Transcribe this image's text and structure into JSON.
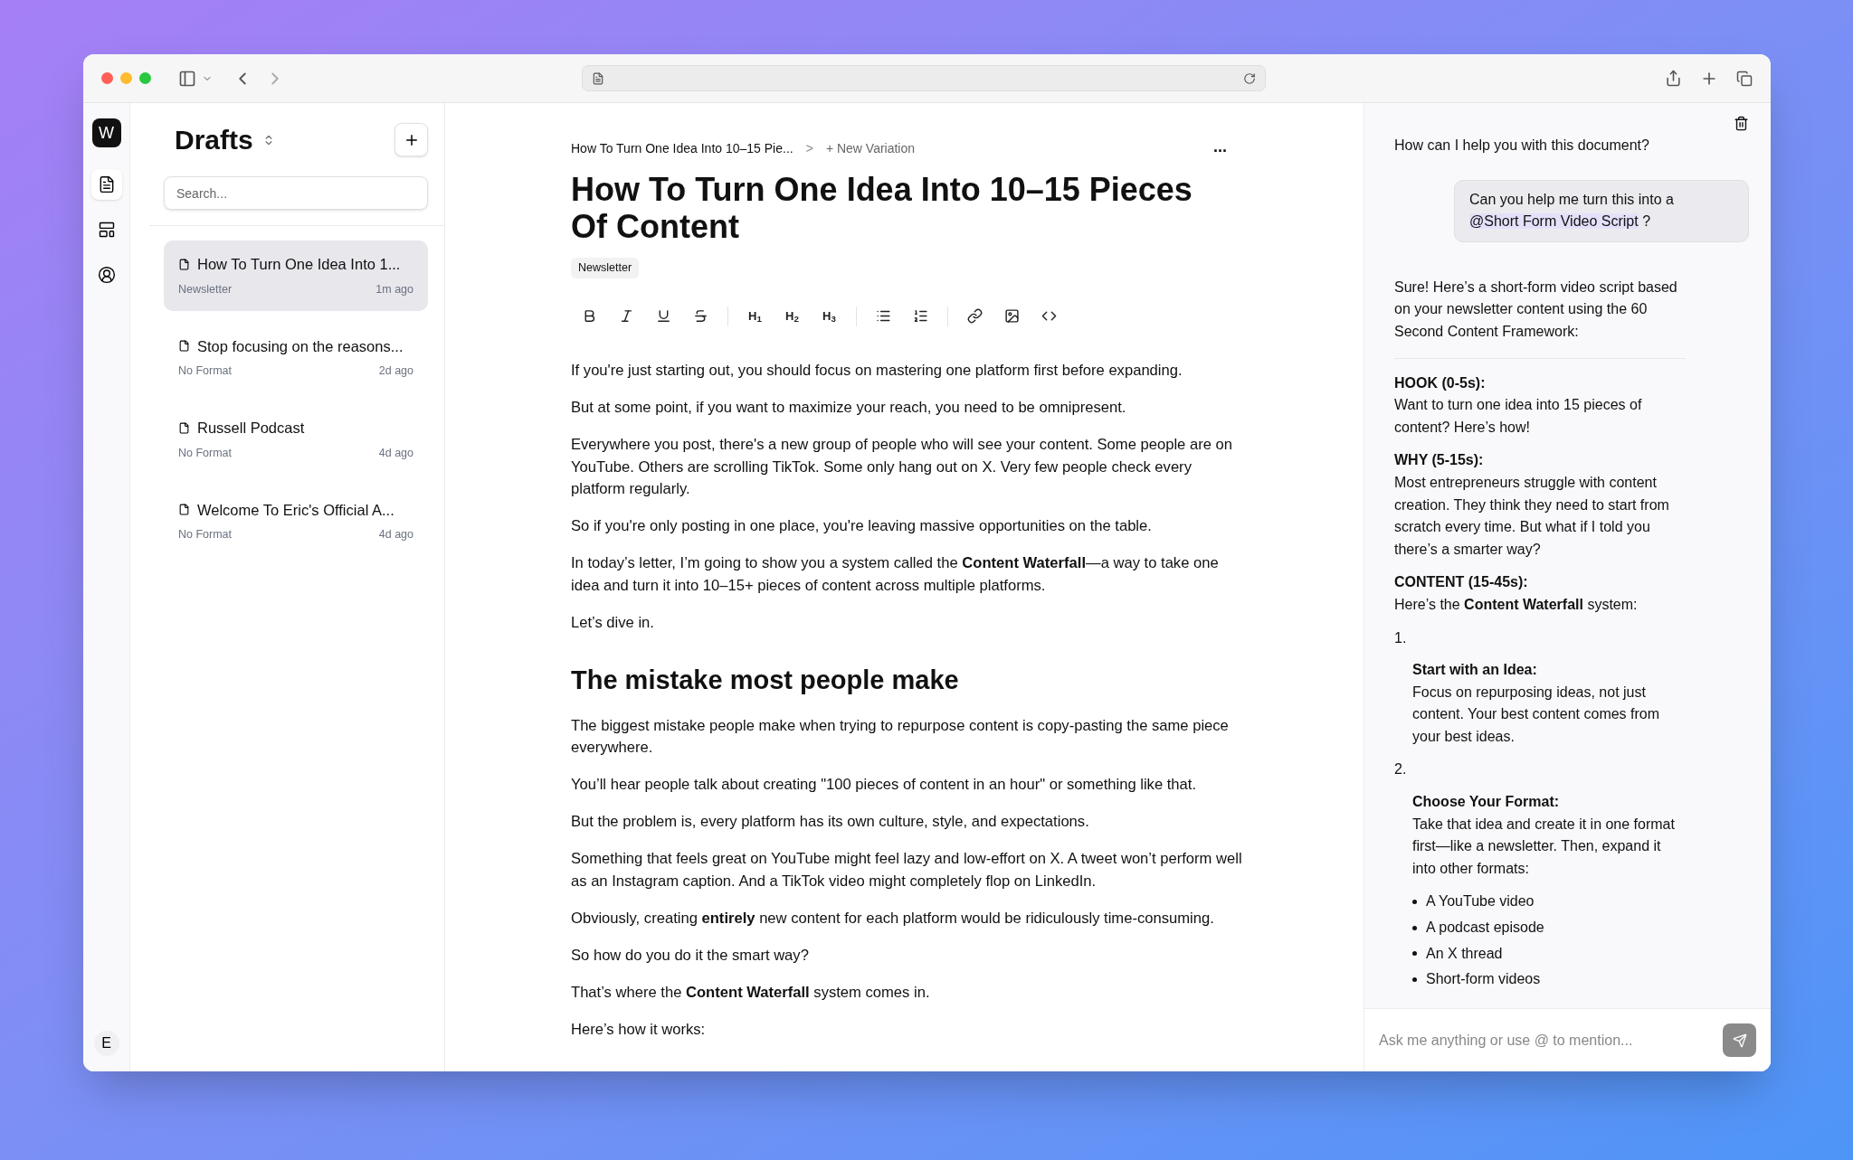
{
  "rail": {
    "logo": "W",
    "user_initial": "E",
    "items": [
      {
        "selected": true
      },
      {
        "selected": false
      },
      {
        "selected": false
      }
    ]
  },
  "drafts": {
    "title": "Drafts",
    "search": {
      "placeholder": "Search..."
    },
    "items": [
      {
        "title": "How To Turn One Idea Into 1...",
        "format": "Newsletter",
        "time": "1m ago",
        "selected": true
      },
      {
        "title": "Stop focusing on the reasons...",
        "format": "No Format",
        "time": "2d ago",
        "selected": false
      },
      {
        "title": "Russell Podcast",
        "format": "No Format",
        "time": "4d ago",
        "selected": false
      },
      {
        "title": "Welcome To Eric's Official A...",
        "format": "No Format",
        "time": "4d ago",
        "selected": false
      }
    ]
  },
  "editor": {
    "breadcrumb": "How To Turn One Idea Into 10–15 Pie...",
    "breadcrumb_separator": ">",
    "new_variation": "+ New Variation",
    "more": "...",
    "title": "How To Turn One Idea Into 10–15 Pieces Of Content",
    "tag": "Newsletter",
    "toolbar": [
      {
        "kind": "bold"
      },
      {
        "kind": "italic"
      },
      {
        "kind": "underline"
      },
      {
        "kind": "strike"
      },
      {
        "kind": "separator"
      },
      {
        "kind": "heading",
        "label": "H$_{1}$"
      },
      {
        "kind": "heading",
        "label": "H$_{2}$"
      },
      {
        "kind": "heading",
        "label": "H$_{3}$"
      },
      {
        "kind": "separator"
      },
      {
        "kind": "bullets"
      },
      {
        "kind": "numbers"
      },
      {
        "kind": "separator"
      },
      {
        "kind": "link"
      },
      {
        "kind": "image"
      },
      {
        "kind": "code"
      }
    ],
    "blocks": [
      {
        "kind": "p",
        "text": "If you're just starting out, you should focus on mastering one platform first before expanding."
      },
      {
        "kind": "p",
        "text": "But at some point, if you want to maximize your reach, you need to be omnipresent."
      },
      {
        "kind": "p",
        "text": "Everywhere you post, there's a new group of people who will see your content. Some people are on YouTube. Others are scrolling TikTok. Some only hang out on X. Very few people check every platform regularly."
      },
      {
        "kind": "p",
        "text": "So if you're only posting in one place, you're leaving massive opportunities on the table."
      },
      {
        "kind": "p",
        "text": "In today’s letter, I’m going to show you a system called the **Content Waterfall**—a way to take one idea and turn it into 10–15+ pieces of content across multiple platforms."
      },
      {
        "kind": "p",
        "text": "Let’s dive in."
      },
      {
        "kind": "h2",
        "text": "The mistake most people make"
      },
      {
        "kind": "p",
        "text": "The biggest mistake people make when trying to repurpose content is copy-pasting the same piece everywhere."
      },
      {
        "kind": "p",
        "text": "You’ll hear people talk about creating \"100 pieces of content in an hour\" or something like that."
      },
      {
        "kind": "p",
        "text": "But the problem is, every platform has its own culture, style, and expectations."
      },
      {
        "kind": "p",
        "text": "Something that feels great on YouTube might feel lazy and low-effort on X. A tweet won’t perform well as an Instagram caption. And a TikTok video might completely flop on LinkedIn."
      },
      {
        "kind": "p",
        "text": "Obviously, creating **entirely** new content for each platform would be ridiculously time-consuming."
      },
      {
        "kind": "p",
        "text": "So how do you do it the smart way?"
      },
      {
        "kind": "p",
        "text": "That’s where the **Content Waterfall** system comes in."
      },
      {
        "kind": "p",
        "text": "Here’s how it works:"
      }
    ]
  },
  "chat": {
    "greeting": "How can I help you with this document?",
    "user_message": {
      "text": "Can you help me turn this into a",
      "mention": "@Short Form Video Script",
      "suffix": "?"
    },
    "intro": "Sure! Here’s a short-form video script based on your newsletter content using the 60 Second Content Framework:",
    "sections": [
      {
        "heading": "HOOK (0-5s):",
        "text": "Want to turn one idea into 15 pieces of content? Here’s how!"
      },
      {
        "heading": "WHY (5-15s):",
        "text": "Most entrepreneurs struggle with content creation. They think they need to start from scratch every time. But what if I told you there’s a smarter way?"
      },
      {
        "heading": "CONTENT (15-45s):",
        "text": "Here’s the **Content Waterfall** system:"
      }
    ],
    "steps": [
      {
        "number": "1.",
        "heading": "Start with an Idea:",
        "text": "Focus on repurposing ideas, not just content. Your best content comes from your best ideas."
      },
      {
        "number": "2.",
        "heading": "Choose Your Format:",
        "text": "Take that idea and create it in one format first—like a newsletter. Then, expand it into other formats:",
        "bullets": [
          "A YouTube video",
          "A podcast episode",
          "An X thread",
          "Short-form videos"
        ]
      }
    ],
    "input": {
      "placeholder": "Ask me anything or use @ to mention..."
    }
  }
}
